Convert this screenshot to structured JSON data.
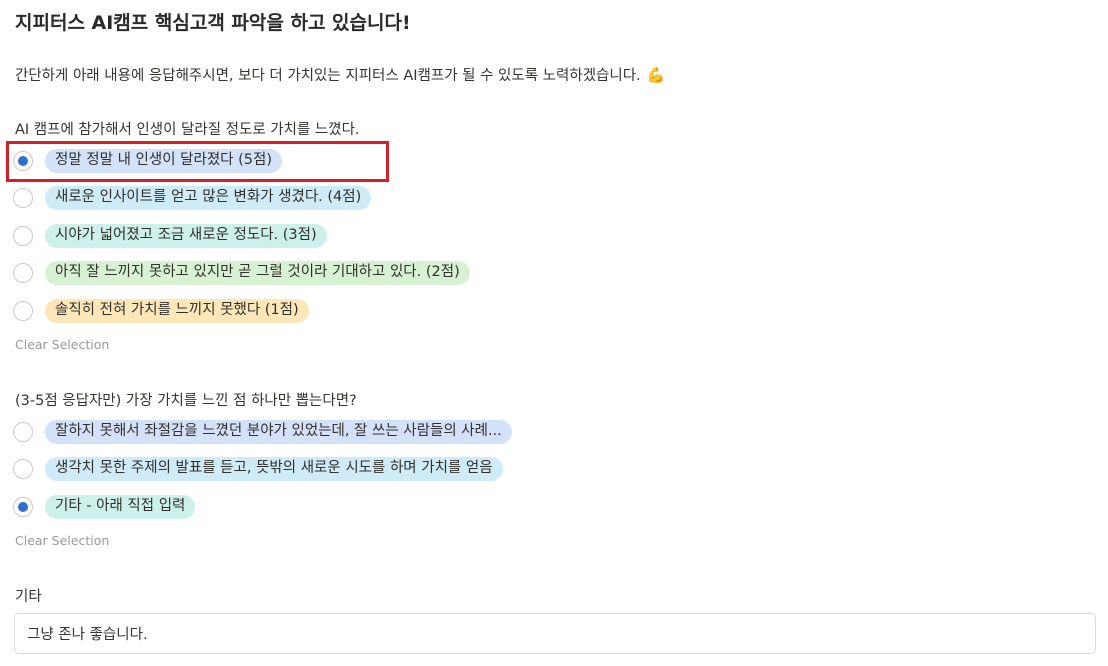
{
  "form": {
    "title": "지피터스 AI캠프 핵심고객 파악을 하고 있습니다!",
    "intro": "간단하게 아래 내용에 응답해주시면, 보다 더 가치있는 지피터스 AI캠프가 될 수 있도록 노력하겠습니다.",
    "intro_emoji": "💪"
  },
  "q1": {
    "label": "AI 캠프에 참가해서 인생이 달라질 정도로 가치를 느꼈다.",
    "options": [
      {
        "label": "정말 정말 내 인생이 달라졌다 (5점)",
        "color": "#d3e2f9",
        "selected": true
      },
      {
        "label": "새로운 인사이트를 얻고 많은 변화가 생겼다. (4점)",
        "color": "#cfebf7",
        "selected": false
      },
      {
        "label": "시야가 넓어졌고 조금 새로운 정도다. (3점)",
        "color": "#cdf0ea",
        "selected": false
      },
      {
        "label": "아직 잘 느끼지 못하고 있지만 곧 그럴 것이라 기대하고 있다. (2점)",
        "color": "#d6f2d3",
        "selected": false
      },
      {
        "label": "솔직히 전혀 가치를 느끼지 못했다 (1점)",
        "color": "#fde7b9",
        "selected": false
      }
    ],
    "clear_label": "Clear Selection"
  },
  "q2": {
    "label": "(3-5점 응답자만) 가장 가치를 느낀 점 하나만 뽑는다면?",
    "options": [
      {
        "label": "잘하지 못해서 좌절감을 느꼈던 분야가 있었는데, 잘 쓰는 사람들의 사례...",
        "color": "#d3e2f9",
        "selected": false
      },
      {
        "label": "생각치 못한 주제의 발표를 듣고, 뜻밖의 새로운 시도를 하며 가치를 얻음",
        "color": "#cfebf7",
        "selected": false
      },
      {
        "label": "기타 - 아래 직접 입력",
        "color": "#cdf0ea",
        "selected": true
      }
    ],
    "clear_label": "Clear Selection"
  },
  "other": {
    "label": "기타",
    "value": "그냥 존나 좋습니다."
  },
  "colors": {
    "radio_selected": "#2f6fcf",
    "highlight_border": "#d4202a"
  }
}
